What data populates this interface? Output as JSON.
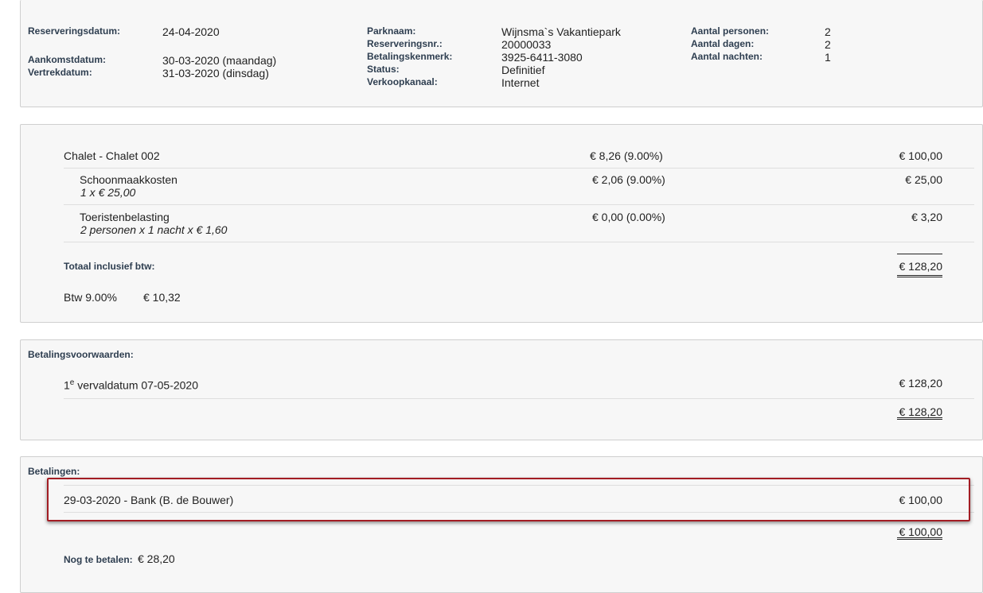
{
  "reservation": {
    "reserveringsdatum_label": "Reserveringsdatum:",
    "reserveringsdatum": "24-04-2020",
    "aankomstdatum_label": "Aankomstdatum:",
    "aankomstdatum": "30-03-2020 (maandag)",
    "vertrekdatum_label": "Vertrekdatum:",
    "vertrekdatum": "31-03-2020 (dinsdag)",
    "parknaam_label": "Parknaam:",
    "parknaam": "Wijnsma`s Vakantiepark",
    "reserveringsnr_label": "Reserveringsnr.:",
    "reserveringsnr": "20000033",
    "betalingskenmerk_label": "Betalingskenmerk:",
    "betalingskenmerk": "3925-6411-3080",
    "status_label": "Status:",
    "status": "Definitief",
    "verkoopkanaal_label": "Verkoopkanaal:",
    "verkoopkanaal": "Internet",
    "personen_label": "Aantal personen:",
    "personen": "2",
    "dagen_label": "Aantal dagen:",
    "dagen": "2",
    "nachten_label": "Aantal nachten:",
    "nachten": "1"
  },
  "costs": {
    "items": [
      {
        "name": "Chalet - Chalet 002",
        "sub": "",
        "vat": "€ 8,26 (9.00%)",
        "amount": "€ 100,00"
      },
      {
        "name": "Schoonmaakkosten",
        "sub": "1 x € 25,00",
        "vat": "€ 2,06 (9.00%)",
        "amount": "€ 25,00"
      },
      {
        "name": "Toeristenbelasting",
        "sub": "2 personen x 1 nacht x € 1,60",
        "vat": "€ 0,00 (0.00%)",
        "amount": "€ 3,20"
      }
    ],
    "total_label": "Totaal inclusief btw:",
    "total": "€ 128,20",
    "btw_label": "Btw 9.00%",
    "btw_value": "€ 10,32"
  },
  "terms": {
    "title": "Betalingsvoorwaarden:",
    "rows": [
      {
        "ordinal": "1",
        "sup": "e",
        "text": " vervaldatum 07-05-2020",
        "amount": "€ 128,20"
      }
    ],
    "total": "€ 128,20"
  },
  "payments": {
    "title": "Betalingen:",
    "rows": [
      {
        "text": "29-03-2020 - Bank (B. de Bouwer)",
        "amount": "€ 100,00"
      }
    ],
    "total": "€ 100,00",
    "remaining_label": "Nog te betalen:",
    "remaining": "€ 28,20"
  },
  "highlight_color": "#a31d24"
}
